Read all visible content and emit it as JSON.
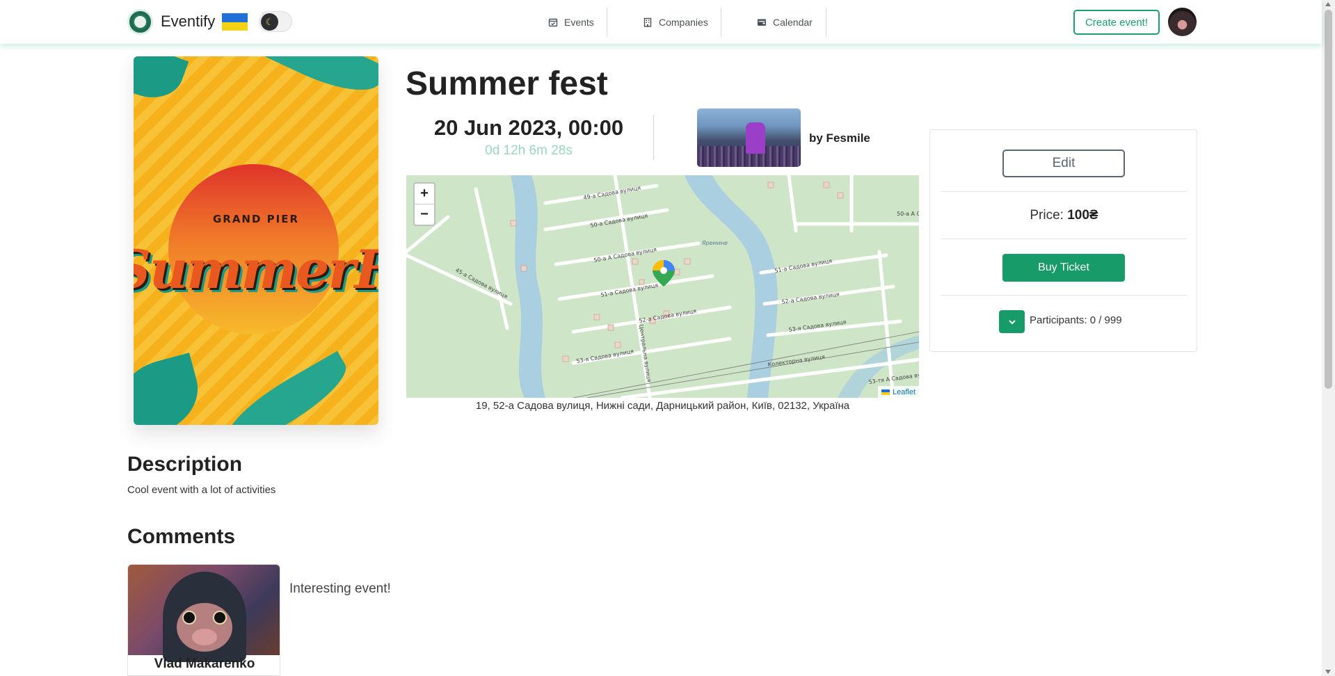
{
  "app": {
    "name": "Eventify"
  },
  "nav": {
    "links": [
      {
        "label": "Events",
        "icon": "calendar-check-icon"
      },
      {
        "label": "Companies",
        "icon": "building-icon"
      },
      {
        "label": "Calendar",
        "icon": "wallet-icon"
      }
    ],
    "create_label": "Create event!"
  },
  "theme": {
    "mode": "dark-moon",
    "toggle_icon": "☾"
  },
  "event": {
    "title": "Summer fest",
    "date": "20 Jun 2023, 00:00",
    "countdown": "0d 12h 6m 28s",
    "organizer": "by Fesmile",
    "address": "19, 52-а Садова вулиця, Нижні сади, Дарницький район, Київ, 02132, Україна",
    "poster": {
      "line1": "GRAND PIER",
      "line2": "SummerFest"
    }
  },
  "map": {
    "zoom_in": "+",
    "zoom_out": "−",
    "attribution": "Leaflet",
    "labels": [
      "49-а Садова вулиця",
      "50-а Садова вулиця",
      "50-а А Садова вулиця",
      "51-а Садова вулиця",
      "52-а Садова вулиця",
      "53-я Садова вулиця",
      "45-а Садова вулиця",
      "Центральна вулиця",
      "Яремине",
      "Колекторна вулиця",
      "53-тя А Садова ву",
      "50-а А С",
      "51-а Садова вулиця",
      "52-а Садова вулиця",
      "53-я Садова вулиця"
    ]
  },
  "sidebar": {
    "edit_label": "Edit",
    "price_label": "Price:",
    "price_value": "100₴",
    "buy_label": "Buy Ticket",
    "participants": "Participants: 0 / 999"
  },
  "description": {
    "heading": "Description",
    "text": "Cool event with a lot of activities"
  },
  "comments": {
    "heading": "Comments",
    "items": [
      {
        "author": "Vlad Makarenko",
        "text": "Interesting event!"
      }
    ]
  },
  "colors": {
    "accent": "#179b69",
    "countdown": "#9ad6c1",
    "map_bg": "#cfe5c7",
    "water": "#a9cfe0"
  }
}
